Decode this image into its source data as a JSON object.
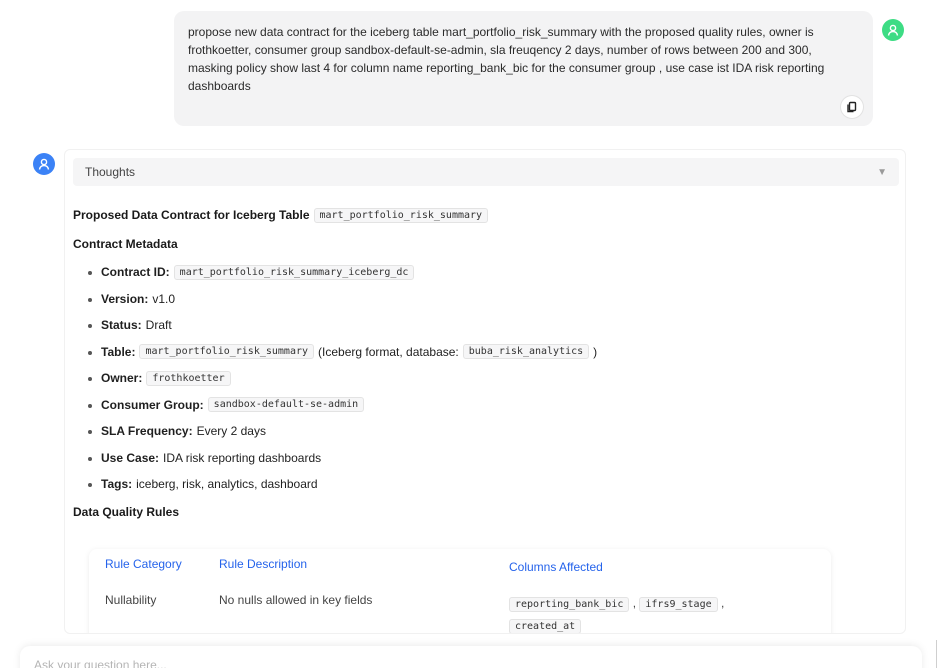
{
  "user_message": {
    "text": "propose new data contract for the iceberg table mart_portfolio_risk_summary with the proposed quality rules, owner is frothkoetter, consumer group sandbox-default-se-admin, sla freuqency 2 days, number of rows between 200 and 300, masking policy show last 4 for column name reporting_bank_bic for the consumer group , use case ist IDA risk reporting dashboards"
  },
  "assistant": {
    "thoughts_label": "Thoughts",
    "title_text": "Proposed Data Contract for Iceberg Table",
    "title_code": "mart_portfolio_risk_summary",
    "metadata_heading": "Contract Metadata",
    "metadata": [
      {
        "key": "Contract ID:",
        "code": "mart_portfolio_risk_summary_iceberg_dc"
      },
      {
        "key": "Version:",
        "value": "v1.0"
      },
      {
        "key": "Status:",
        "value": "Draft"
      },
      {
        "key": "Table:",
        "code": "mart_portfolio_risk_summary",
        "value": "(Iceberg format, database:",
        "code2": "buba_risk_analytics",
        "tail": ")"
      },
      {
        "key": "Owner:",
        "code": "frothkoetter"
      },
      {
        "key": "Consumer Group:",
        "code": "sandbox-default-se-admin"
      },
      {
        "key": "SLA Frequency:",
        "value": "Every 2 days"
      },
      {
        "key": "Use Case:",
        "value": "IDA risk reporting dashboards"
      },
      {
        "key": "Tags:",
        "value": "iceberg, risk, analytics, dashboard"
      }
    ],
    "dq_heading": "Data Quality Rules",
    "rules_table": {
      "headers": [
        "Rule Category",
        "Rule Description",
        "Columns Affected"
      ],
      "rows": [
        {
          "category": "Nullability",
          "description": "No nulls allowed in key fields",
          "columns": [
            "reporting_bank_bic",
            "ifrs9_stage",
            "created_at"
          ]
        }
      ]
    }
  },
  "input": {
    "placeholder": "Ask your question here..."
  }
}
